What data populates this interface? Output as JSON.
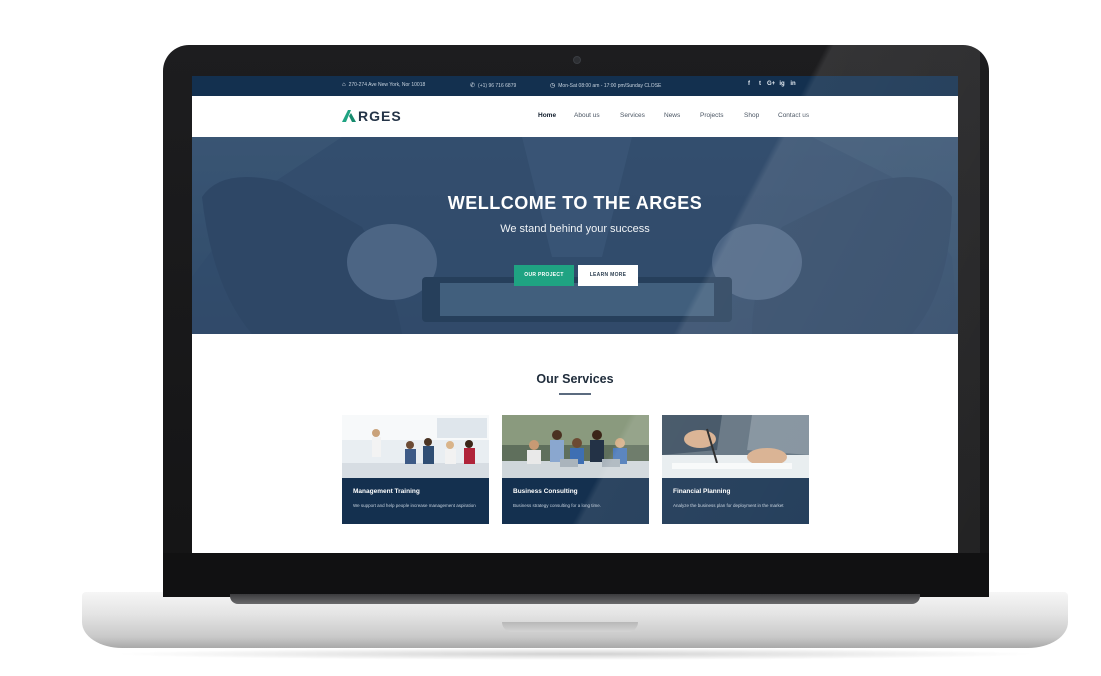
{
  "topbar": {
    "address": "270-274 Ave New York, Nor 10018",
    "phone": "(+1) 96 716 6879",
    "hours": "Mon-Sat 08:00 am - 17:00 pm/Sunday CLOSE",
    "social": [
      "f",
      "t",
      "G+",
      "ig",
      "in"
    ]
  },
  "logo": {
    "text": "RGES",
    "mark_color": "#1fa382"
  },
  "nav": {
    "items": [
      "Home",
      "About us",
      "Services",
      "News",
      "Projects",
      "Shop",
      "Contact us"
    ],
    "active": "Home"
  },
  "hero": {
    "title": "WELLCOME TO THE ARGES",
    "subtitle": "We stand behind your success",
    "primary_button": "OUR PROJECT",
    "secondary_button": "LEARN MORE"
  },
  "services": {
    "heading": "Our Services",
    "cards": [
      {
        "title": "Management Training",
        "description": "We support and help people increase management aspiration"
      },
      {
        "title": "Business Consulting",
        "description": "Business strategy consulting for a long time."
      },
      {
        "title": "Financial Planning",
        "description": "Analyze the business plan for deployment in the market"
      }
    ]
  },
  "colors": {
    "topbar": "#13304f",
    "accent": "#1fa382",
    "card": "#14304f",
    "hero_overlay": "#3d5876"
  }
}
